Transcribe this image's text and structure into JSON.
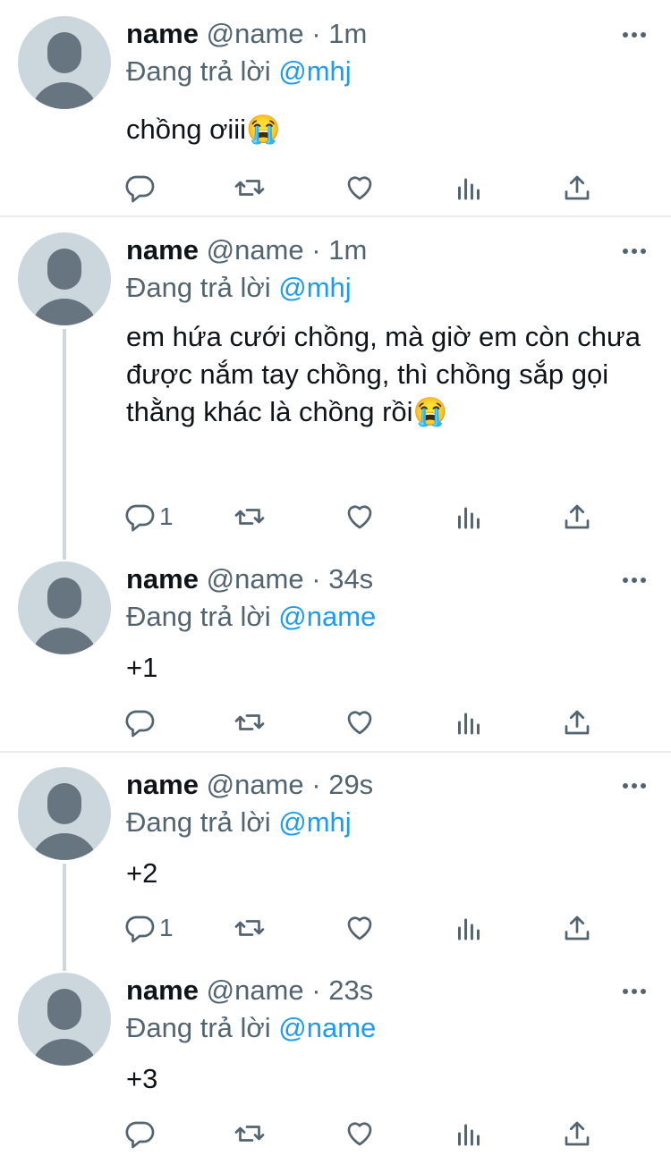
{
  "reply_prefix": "Đang trả lời",
  "colors": {
    "link": "#1d9bf0",
    "muted": "#536471",
    "avatar_bg": "#ccd6dd",
    "avatar_fg": "#66757f"
  },
  "icons": [
    "more-icon",
    "reply-icon",
    "retweet-icon",
    "like-icon",
    "analytics-icon",
    "share-icon"
  ],
  "tweets": [
    {
      "name": "name",
      "handle": "@name",
      "separator": "·",
      "time": "1m",
      "reply_to": "@mhj",
      "text": "chồng ơiii😭",
      "reply_count": ""
    },
    {
      "name": "name",
      "handle": "@name",
      "separator": "·",
      "time": "1m",
      "reply_to": "@mhj",
      "text": "em hứa cưới chồng, mà giờ em còn chưa được nắm tay chồng, thì chồng sắp gọi thằng khác là chồng rồi😭",
      "reply_count": "1"
    },
    {
      "name": "name",
      "handle": "@name",
      "separator": "·",
      "time": "34s",
      "reply_to": "@name",
      "text": "+1",
      "reply_count": ""
    },
    {
      "name": "name",
      "handle": "@name",
      "separator": "·",
      "time": "29s",
      "reply_to": "@mhj",
      "text": "+2",
      "reply_count": "1"
    },
    {
      "name": "name",
      "handle": "@name",
      "separator": "·",
      "time": "23s",
      "reply_to": "@name",
      "text": "+3",
      "reply_count": ""
    }
  ]
}
